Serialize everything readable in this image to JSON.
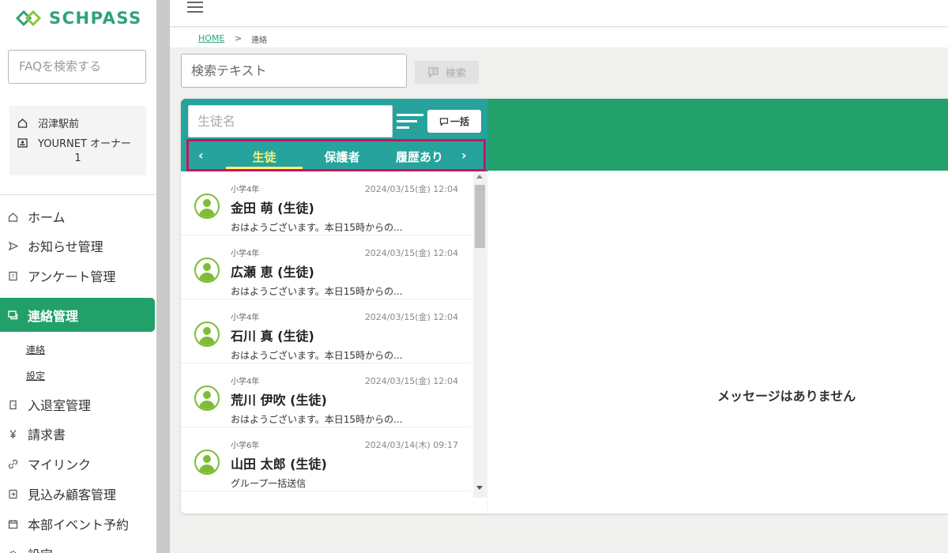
{
  "brand": {
    "name": "SCHPASS"
  },
  "sidebar": {
    "faq_placeholder": "FAQを検索する",
    "user": {
      "school": "沼津駅前",
      "role": "YOURNET オーナー",
      "number": "1"
    },
    "nav": [
      {
        "label": "ホーム",
        "icon": "home-icon"
      },
      {
        "label": "お知らせ管理",
        "icon": "send-icon"
      },
      {
        "label": "アンケート管理",
        "icon": "survey-icon"
      },
      {
        "label": "連絡管理",
        "icon": "chat-icon",
        "active": true
      },
      {
        "label": "入退室管理",
        "icon": "door-icon"
      },
      {
        "label": "請求書",
        "icon": "yen-icon"
      },
      {
        "label": "マイリンク",
        "icon": "link-icon"
      },
      {
        "label": "見込み顧客管理",
        "icon": "prospect-icon"
      },
      {
        "label": "本部イベント予約",
        "icon": "calendar-icon"
      },
      {
        "label": "設定",
        "icon": "gear-icon"
      }
    ],
    "sub_items": [
      "連絡",
      "設定"
    ]
  },
  "breadcrumb": {
    "home": "HOME",
    "separator": ">",
    "current": "連絡"
  },
  "search": {
    "placeholder": "検索テキスト",
    "button_label": "検索"
  },
  "list_panel": {
    "student_placeholder": "生徒名",
    "bulk_label": "一括",
    "tabs": [
      "生徒",
      "保護者",
      "履歴あり"
    ],
    "active_tab": 0,
    "items": [
      {
        "grade": "小学4年",
        "date": "2024/03/15(金) 12:04",
        "name": "金田 萌 (生徒)",
        "message": "おはようございます。本日15時からの..."
      },
      {
        "grade": "小学4年",
        "date": "2024/03/15(金) 12:04",
        "name": "広瀬 恵 (生徒)",
        "message": "おはようございます。本日15時からの..."
      },
      {
        "grade": "小学4年",
        "date": "2024/03/15(金) 12:04",
        "name": "石川 真 (生徒)",
        "message": "おはようございます。本日15時からの..."
      },
      {
        "grade": "小学4年",
        "date": "2024/03/15(金) 12:04",
        "name": "荒川 伊吹 (生徒)",
        "message": "おはようございます。本日15時からの..."
      },
      {
        "grade": "小学6年",
        "date": "2024/03/14(木) 09:17",
        "name": "山田 太郎 (生徒)",
        "message": "グループ一括送信"
      }
    ]
  },
  "message_panel": {
    "empty_text": "メッセージはありません"
  },
  "colors": {
    "brand_green": "#22a06a",
    "teal": "#26a39c",
    "tab_active": "#fff176",
    "highlight": "#c2185b"
  }
}
